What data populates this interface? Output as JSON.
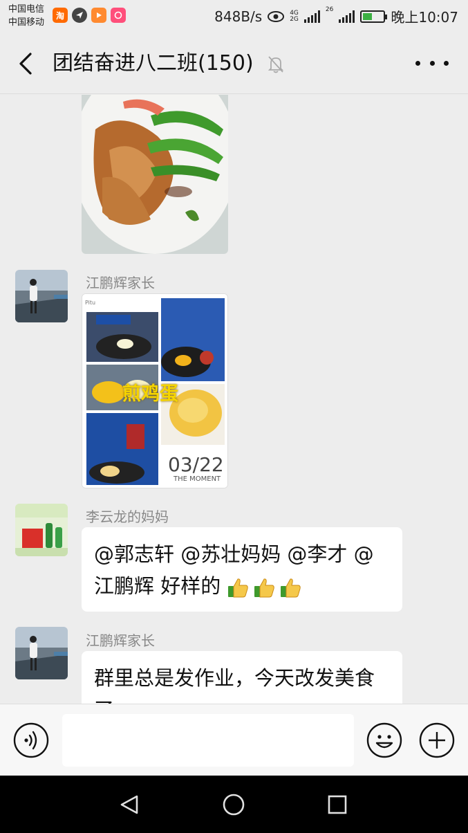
{
  "status_bar": {
    "carrier_1": "中国电信",
    "carrier_2": "中国移动",
    "app_icon_taobao": "淘",
    "net_speed": "848B/s",
    "network_1": "4G",
    "network_2": "2G",
    "network_3": "26",
    "time": "晚上10:07"
  },
  "header": {
    "title": "团结奋进八二班(150)"
  },
  "messages": [
    {
      "type": "image",
      "description_icon": "food-photo"
    },
    {
      "type": "image",
      "sender": "江鹏辉家长",
      "collage_caption": "煎鸡蛋",
      "collage_date": "03/22",
      "collage_sub": "THE MOMENT",
      "collage_tag": "Pitu"
    },
    {
      "type": "text",
      "sender": "李云龙的妈妈",
      "text": "@郭志轩 @苏壮妈妈 @李才 @江鹏辉  好样的"
    },
    {
      "type": "text",
      "sender": "江鹏辉家长",
      "text": "群里总是发作业，今天改发美食了"
    }
  ],
  "colors": {
    "background": "#ededed",
    "bubble": "#ffffff",
    "sender_name": "#888888",
    "battery": "#3cb043"
  }
}
